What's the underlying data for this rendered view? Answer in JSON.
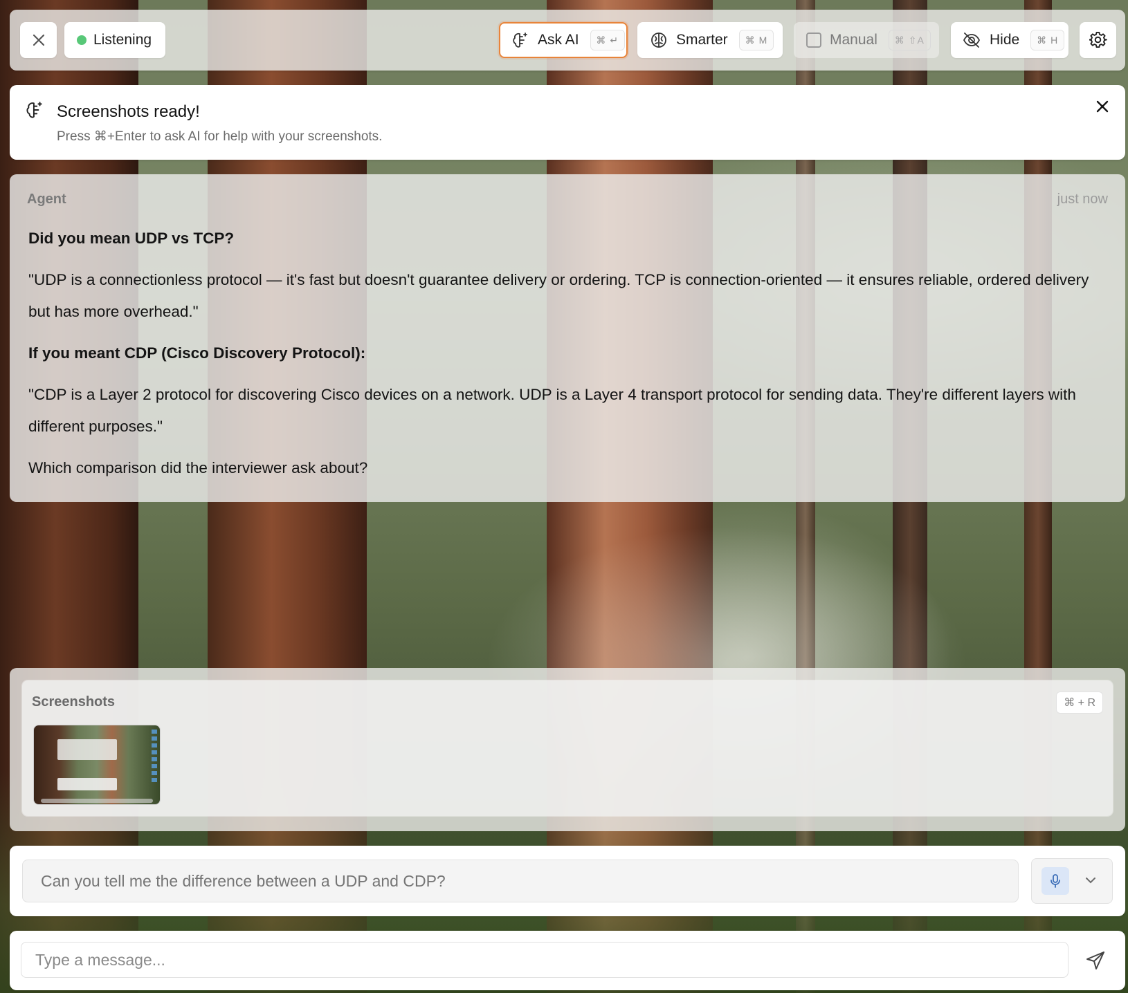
{
  "toolbar": {
    "listening_label": "Listening",
    "ask_ai": {
      "label": "Ask AI",
      "shortcut": "⌘ ↵"
    },
    "smarter": {
      "label": "Smarter",
      "shortcut": "⌘ M"
    },
    "manual": {
      "label": "Manual",
      "shortcut": "⌘ ⇧A"
    },
    "hide": {
      "label": "Hide",
      "shortcut": "⌘ H"
    },
    "icons": {
      "close": "close-icon",
      "status": "status-dot-icon",
      "ask_ai": "brain-sparkle-icon",
      "smarter": "brain-icon",
      "manual": "checkbox-icon",
      "hide": "eye-off-icon",
      "settings": "gear-icon"
    }
  },
  "notification": {
    "title": "Screenshots ready!",
    "subtitle": "Press ⌘+Enter to ask AI for help with your screenshots."
  },
  "agent_message": {
    "role": "Agent",
    "time": "just now",
    "heading1": "Did you mean UDP vs TCP?",
    "para1": "\"UDP is a connectionless protocol — it's fast but doesn't guarantee delivery or ordering. TCP is connection-oriented — it ensures reliable, ordered delivery but has more overhead.\"",
    "heading2": "If you meant CDP (Cisco Discovery Protocol):",
    "para2": "\"CDP is a Layer 2 protocol for discovering Cisco devices on a network. UDP is a Layer 4 transport protocol for sending data. They're different layers with different purposes.\"",
    "question": "Which comparison did the interviewer ask about?"
  },
  "screenshots": {
    "title": "Screenshots",
    "shortcut": "⌘ + R"
  },
  "transcript": {
    "text": "Can you tell me the difference between a UDP and CDP?"
  },
  "composer": {
    "placeholder": "Type a message..."
  },
  "colors": {
    "accent_orange": "#e8843a",
    "status_green": "#58c878",
    "mic_bg": "#dbe6f7"
  }
}
